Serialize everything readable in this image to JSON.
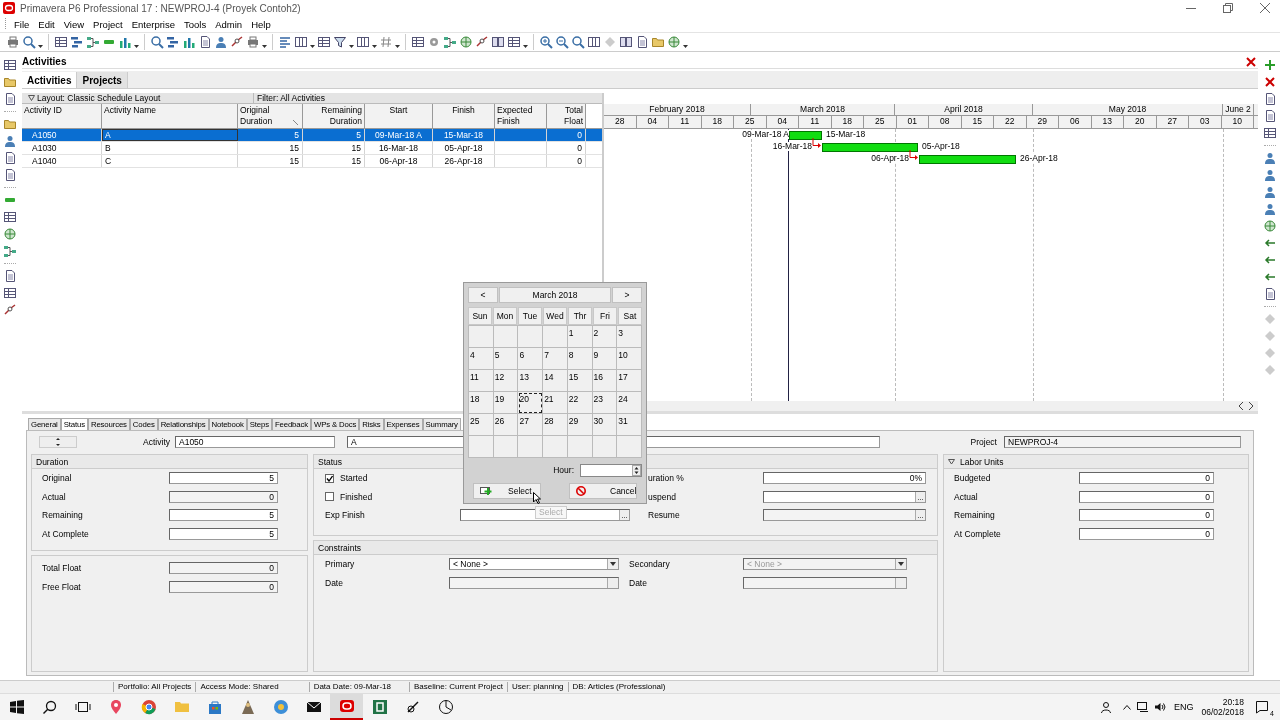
{
  "window": {
    "title": "Primavera P6 Professional 17 : NEWPROJ-4 (Proyek Contoh2)"
  },
  "menu": [
    "File",
    "Edit",
    "View",
    "Project",
    "Enterprise",
    "Tools",
    "Admin",
    "Help"
  ],
  "workspace": {
    "title": "Activities",
    "tabs": [
      {
        "label": "Activities",
        "selected": true
      },
      {
        "label": "Projects",
        "selected": false
      }
    ]
  },
  "layout_bar": {
    "layout": "Layout: Classic Schedule Layout",
    "filter": "Filter: All Activities"
  },
  "table": {
    "columns": [
      "Activity ID",
      "Activity Name",
      "Original Duration",
      "Remaining Duration",
      "Start",
      "Finish",
      "Expected Finish",
      "Total Float"
    ],
    "rows": [
      {
        "selected": true,
        "id": "A1050",
        "name": "A",
        "original_duration": "5",
        "remaining_duration": "5",
        "start": "09-Mar-18 A",
        "finish": "15-Mar-18",
        "total_float": "0"
      },
      {
        "selected": false,
        "id": "A1030",
        "name": "B",
        "original_duration": "15",
        "remaining_duration": "15",
        "start": "16-Mar-18",
        "finish": "05-Apr-18",
        "total_float": "0"
      },
      {
        "selected": false,
        "id": "A1040",
        "name": "C",
        "original_duration": "15",
        "remaining_duration": "15",
        "start": "06-Apr-18",
        "finish": "26-Apr-18",
        "total_float": "0"
      }
    ]
  },
  "gantt": {
    "months": [
      "February 2018",
      "March 2018",
      "April 2018",
      "May 2018",
      "June 2"
    ],
    "weeks": [
      "28",
      "04",
      "11",
      "18",
      "25",
      "04",
      "11",
      "18",
      "25",
      "01",
      "08",
      "15",
      "22",
      "29",
      "06",
      "13",
      "20",
      "27",
      "03",
      "10"
    ],
    "bars": [
      {
        "start_label": "09-Mar-18 A",
        "finish_label": "15-Mar-18"
      },
      {
        "start_label": "16-Mar-18",
        "finish_label": "05-Apr-18"
      },
      {
        "start_label": "06-Apr-18",
        "finish_label": "26-Apr-18"
      }
    ]
  },
  "detail": {
    "tabs": [
      {
        "label": "General",
        "selected": false
      },
      {
        "label": "Status",
        "selected": true
      },
      {
        "label": "Resources",
        "selected": false
      },
      {
        "label": "Codes",
        "selected": false
      },
      {
        "label": "Relationships",
        "selected": false
      },
      {
        "label": "Notebook",
        "selected": false
      },
      {
        "label": "Steps",
        "selected": false
      },
      {
        "label": "Feedback",
        "selected": false
      },
      {
        "label": "WPs & Docs",
        "selected": false
      },
      {
        "label": "Risks",
        "selected": false
      },
      {
        "label": "Expenses",
        "selected": false
      },
      {
        "label": "Summary",
        "selected": false
      }
    ],
    "activity_label": "Activity",
    "activity_id": "A1050",
    "activity_name": "A",
    "project_label": "Project",
    "project": "NEWPROJ-4",
    "duration": {
      "title": "Duration",
      "fields": [
        {
          "label": "Original",
          "value": "5",
          "readonly": false
        },
        {
          "label": "Actual",
          "value": "0",
          "readonly": true
        },
        {
          "label": "Remaining",
          "value": "5",
          "readonly": false
        },
        {
          "label": "At Complete",
          "value": "5",
          "readonly": false
        }
      ],
      "float_fields": [
        {
          "label": "Total Float",
          "value": "0",
          "readonly": true
        },
        {
          "label": "Free Float",
          "value": "0",
          "readonly": true
        }
      ]
    },
    "status": {
      "title": "Status",
      "checkboxes": [
        {
          "label": "Started",
          "checked": true
        },
        {
          "label": "Finished",
          "checked": false
        }
      ],
      "exp_finish": {
        "label": "Exp Finish",
        "kind": "picker",
        "button": "...",
        "readonly": false
      },
      "right_fields": [
        {
          "label": "uration %",
          "kind": "text",
          "value": "0%",
          "readonly": false
        },
        {
          "label": "uspend",
          "kind": "picker",
          "button": "...",
          "readonly": false
        },
        {
          "label": "Resume",
          "kind": "picker",
          "button": "...",
          "readonly": true
        }
      ]
    },
    "constraints": {
      "title": "Constraints",
      "left": [
        {
          "label": "Primary",
          "kind": "dropdown",
          "value": "< None >",
          "readonly": false
        },
        {
          "label": "Date",
          "kind": "date",
          "readonly": true
        }
      ],
      "right": [
        {
          "label": "Secondary",
          "kind": "dropdown",
          "value": "< None >",
          "readonly": true
        },
        {
          "label": "Date",
          "kind": "date",
          "readonly": true
        }
      ]
    },
    "labor_units": {
      "title": "Labor Units",
      "expanded": true,
      "fields": [
        {
          "label": "Budgeted",
          "value": "0",
          "readonly": false
        },
        {
          "label": "Actual",
          "value": "0",
          "readonly": false
        },
        {
          "label": "Remaining",
          "value": "0",
          "readonly": false
        },
        {
          "label": "At Complete",
          "value": "0",
          "readonly": false
        }
      ]
    }
  },
  "calendar": {
    "prev": "<",
    "month": "March 2018",
    "next": ">",
    "weekdays": [
      "Sun",
      "Mon",
      "Tue",
      "Wed",
      "Thr",
      "Fri",
      "Sat"
    ],
    "weeks": [
      [
        {
          "kind": "blank"
        },
        {
          "kind": "blank"
        },
        {
          "kind": "blank"
        },
        {
          "kind": "blank"
        },
        {
          "kind": "day",
          "day": "1",
          "selected": false
        },
        {
          "kind": "day",
          "day": "2",
          "selected": false
        },
        {
          "kind": "day",
          "day": "3",
          "selected": false
        }
      ],
      [
        {
          "kind": "day",
          "day": "4",
          "selected": false
        },
        {
          "kind": "day",
          "day": "5",
          "selected": false
        },
        {
          "kind": "day",
          "day": "6",
          "selected": false
        },
        {
          "kind": "day",
          "day": "7",
          "selected": false
        },
        {
          "kind": "day",
          "day": "8",
          "selected": false
        },
        {
          "kind": "day",
          "day": "9",
          "selected": false
        },
        {
          "kind": "day",
          "day": "10",
          "selected": false
        }
      ],
      [
        {
          "kind": "day",
          "day": "11",
          "selected": false
        },
        {
          "kind": "day",
          "day": "12",
          "selected": false
        },
        {
          "kind": "day",
          "day": "13",
          "selected": false
        },
        {
          "kind": "day",
          "day": "14",
          "selected": false
        },
        {
          "kind": "day",
          "day": "15",
          "selected": false
        },
        {
          "kind": "day",
          "day": "16",
          "selected": false
        },
        {
          "kind": "day",
          "day": "17",
          "selected": false
        }
      ],
      [
        {
          "kind": "day",
          "day": "18",
          "selected": false
        },
        {
          "kind": "day",
          "day": "19",
          "selected": false
        },
        {
          "kind": "day",
          "day": "20",
          "selected": true
        },
        {
          "kind": "day",
          "day": "21",
          "selected": false
        },
        {
          "kind": "day",
          "day": "22",
          "selected": false
        },
        {
          "kind": "day",
          "day": "23",
          "selected": false
        },
        {
          "kind": "day",
          "day": "24",
          "selected": false
        }
      ],
      [
        {
          "kind": "day",
          "day": "25",
          "selected": false
        },
        {
          "kind": "day",
          "day": "26",
          "selected": false
        },
        {
          "kind": "day",
          "day": "27",
          "selected": false
        },
        {
          "kind": "day",
          "day": "28",
          "selected": false
        },
        {
          "kind": "day",
          "day": "29",
          "selected": false
        },
        {
          "kind": "day",
          "day": "30",
          "selected": false
        },
        {
          "kind": "day",
          "day": "31",
          "selected": false
        }
      ],
      [
        {
          "kind": "blank"
        },
        {
          "kind": "blank"
        },
        {
          "kind": "blank"
        },
        {
          "kind": "blank"
        },
        {
          "kind": "blank"
        },
        {
          "kind": "blank"
        },
        {
          "kind": "blank"
        }
      ]
    ],
    "hour_label": "Hour:",
    "buttons": [
      {
        "label": "Select",
        "kind": "select"
      },
      {
        "label": "Cancel",
        "kind": "cancel"
      }
    ],
    "tooltip": "Select"
  },
  "status_bar": [
    "Portfolio: All Projects",
    "Access Mode: Shared",
    "Data Date: 09-Mar-18",
    "Baseline: Current Project",
    "User: planning",
    "DB: Articles (Professional)"
  ],
  "taskbar": {
    "language": "ENG",
    "time": "20:18",
    "date": "06/02/2018",
    "notifications": "4"
  }
}
